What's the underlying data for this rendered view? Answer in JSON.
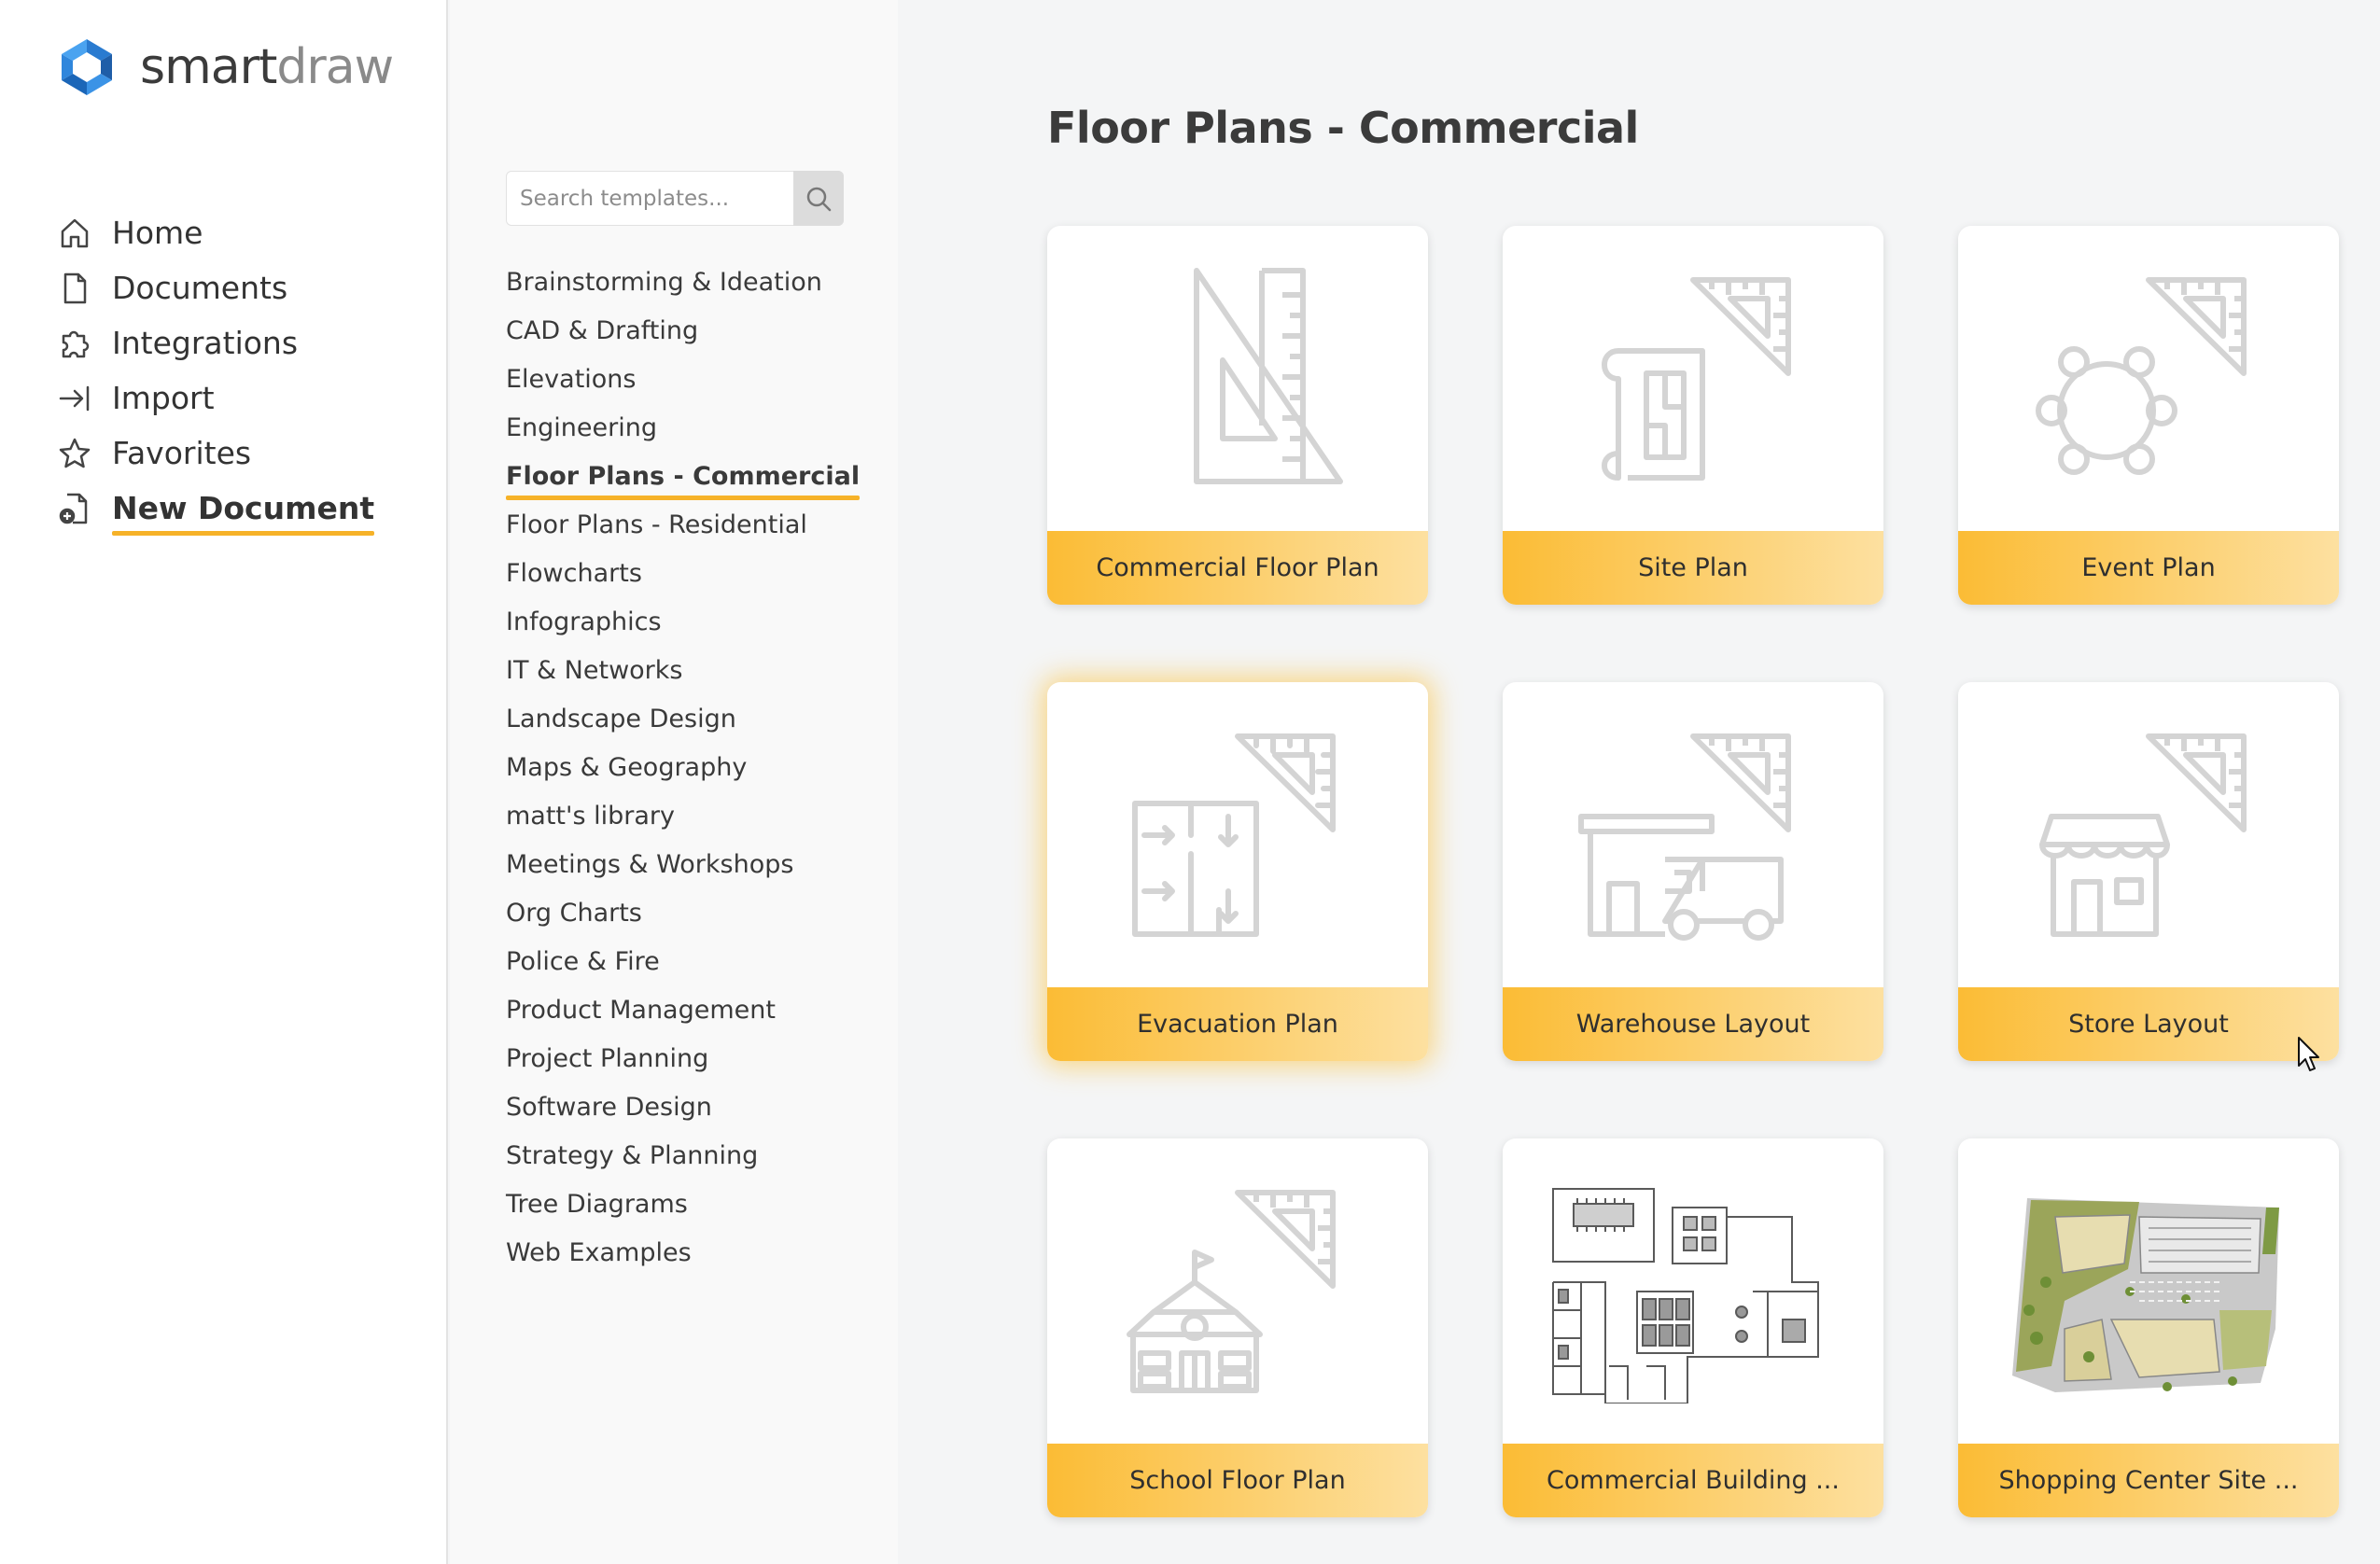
{
  "app": {
    "brand_dark": "smart",
    "brand_light": "draw",
    "accent": "#f6b228"
  },
  "nav": {
    "items": [
      {
        "label": "Home",
        "icon": "home-icon"
      },
      {
        "label": "Documents",
        "icon": "document-icon"
      },
      {
        "label": "Integrations",
        "icon": "puzzle-icon"
      },
      {
        "label": "Import",
        "icon": "import-arrow-icon"
      },
      {
        "label": "Favorites",
        "icon": "star-icon"
      },
      {
        "label": "New Document",
        "icon": "new-document-icon",
        "active": true
      }
    ]
  },
  "search": {
    "placeholder": "Search templates...",
    "icon": "search-icon"
  },
  "categories": [
    "Brainstorming & Ideation",
    "CAD & Drafting",
    "Elevations",
    "Engineering",
    "Floor Plans - Commercial",
    "Floor Plans - Residential",
    "Flowcharts",
    "Infographics",
    "IT & Networks",
    "Landscape Design",
    "Maps & Geography",
    "matt's library",
    "Meetings & Workshops",
    "Org Charts",
    "Police & Fire",
    "Product Management",
    "Project Planning",
    "Software Design",
    "Strategy & Planning",
    "Tree Diagrams",
    "Web Examples"
  ],
  "active_category": "Floor Plans - Commercial",
  "page_title": "Floor Plans - Commercial",
  "templates": [
    {
      "label": "Commercial Floor Plan",
      "icon": "drafting-triangle-icon"
    },
    {
      "label": "Site Plan",
      "icon": "site-plan-icon"
    },
    {
      "label": "Event Plan",
      "icon": "round-table-icon"
    },
    {
      "label": "Evacuation Plan",
      "icon": "evacuation-plan-icon",
      "hover": true
    },
    {
      "label": "Warehouse Layout",
      "icon": "warehouse-truck-icon"
    },
    {
      "label": "Store Layout",
      "icon": "storefront-icon"
    },
    {
      "label": "School Floor Plan",
      "icon": "school-building-icon"
    },
    {
      "label": "Commercial Building ...",
      "icon": "commercial-building-thumbnail"
    },
    {
      "label": "Shopping Center Site ...",
      "icon": "shopping-center-thumbnail"
    }
  ]
}
